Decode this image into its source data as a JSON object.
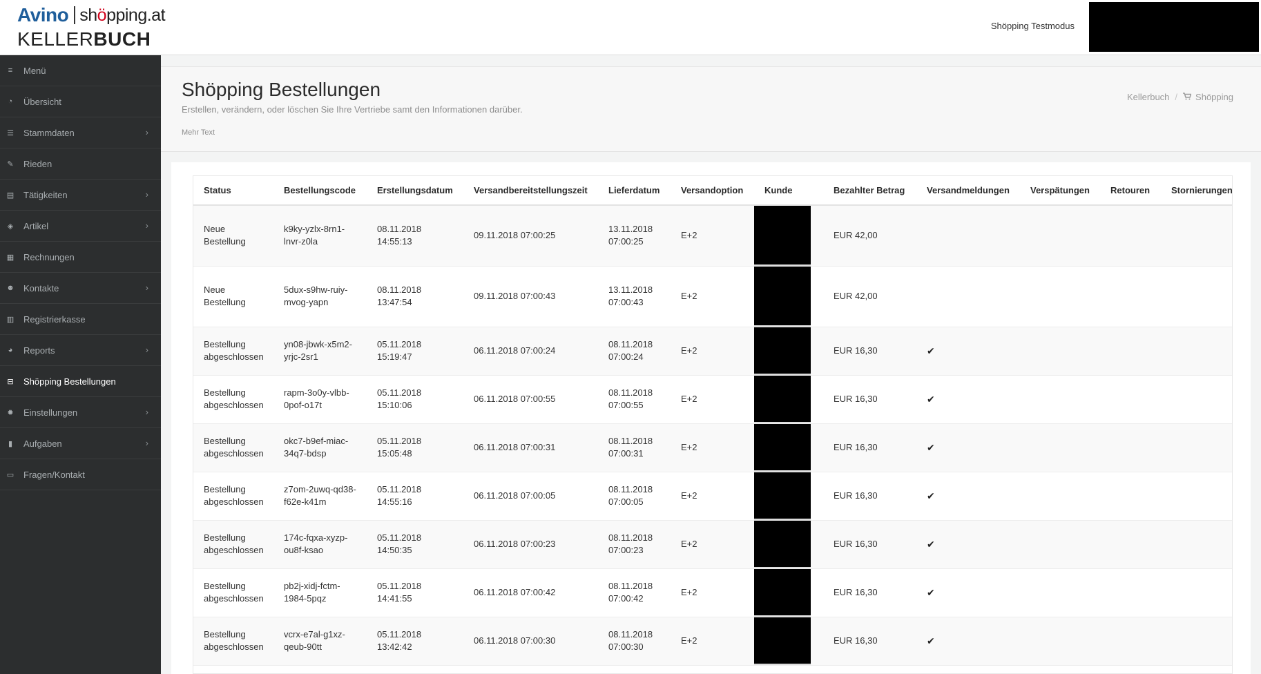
{
  "header": {
    "logo": {
      "brand": "Avino",
      "shop_prefix": "sh",
      "shop_mid": "ö",
      "shop_suffix": "pping.at",
      "line2_light": "KELLER",
      "line2_bold": "BUCH"
    },
    "testmode_label": "Shöpping Testmodus"
  },
  "sidebar": {
    "items": [
      {
        "label": "Menü",
        "icon": "bars-icon",
        "glyph": "≡",
        "has_children": false
      },
      {
        "label": "Übersicht",
        "icon": "dashboard-icon",
        "glyph": "◔",
        "has_children": false
      },
      {
        "label": "Stammdaten",
        "icon": "sliders-icon",
        "glyph": "☰",
        "has_children": true
      },
      {
        "label": "Rieden",
        "icon": "pencil-icon",
        "glyph": "✎",
        "has_children": false
      },
      {
        "label": "Tätigkeiten",
        "icon": "book-icon",
        "glyph": "▤",
        "has_children": true
      },
      {
        "label": "Artikel",
        "icon": "cube-icon",
        "glyph": "◈",
        "has_children": true
      },
      {
        "label": "Rechnungen",
        "icon": "list-alt-icon",
        "glyph": "▦",
        "has_children": false
      },
      {
        "label": "Kontakte",
        "icon": "users-icon",
        "glyph": "☻",
        "has_children": true
      },
      {
        "label": "Registrierkasse",
        "icon": "calculator-icon",
        "glyph": "▥",
        "has_children": false
      },
      {
        "label": "Reports",
        "icon": "pie-chart-icon",
        "glyph": "◕",
        "has_children": true
      },
      {
        "label": "Shöpping Bestellungen",
        "icon": "inbox-icon",
        "glyph": "⊟",
        "has_children": false,
        "active": true
      },
      {
        "label": "Einstellungen",
        "icon": "cog-icon",
        "glyph": "✹",
        "has_children": true
      },
      {
        "label": "Aufgaben",
        "icon": "bookmark-icon",
        "glyph": "▮",
        "has_children": true
      },
      {
        "label": "Fragen/Kontakt",
        "icon": "id-card-icon",
        "glyph": "▭",
        "has_children": false
      }
    ],
    "chevron": "›"
  },
  "page": {
    "title": "Shöpping Bestellungen",
    "subtitle": "Erstellen, verändern, oder löschen Sie Ihre Vertriebe samt den Informationen darüber.",
    "more_text": "Mehr Text",
    "breadcrumb": {
      "home": "Kellerbuch",
      "separator": "/",
      "current": "Shöpping",
      "current_icon": "shopping-cart-icon"
    }
  },
  "table": {
    "columns": [
      "Status",
      "Bestellungscode",
      "Erstellungsdatum",
      "Versandbereitstellungszeit",
      "Lieferdatum",
      "Versandoption",
      "Kunde",
      "Bezahlter Betrag",
      "Versandmeldungen",
      "Verspätungen",
      "Retouren",
      "Stornierungen"
    ],
    "rows": [
      {
        "status_1": "Neue",
        "status_2": "Bestellung",
        "code_1": "k9ky-yzlx-8rn1-",
        "code_2": "lnvr-z0la",
        "created_1": "08.11.2018",
        "created_2": "14:55:13",
        "ready": "09.11.2018 07:00:25",
        "delivery_1": "13.11.2018",
        "delivery_2": "07:00:25",
        "option": "E+2",
        "amount": "EUR 42,00",
        "shipped": ""
      },
      {
        "status_1": "Neue",
        "status_2": "Bestellung",
        "code_1": "5dux-s9hw-ruiy-",
        "code_2": "mvog-yapn",
        "created_1": "08.11.2018",
        "created_2": "13:47:54",
        "ready": "09.11.2018 07:00:43",
        "delivery_1": "13.11.2018",
        "delivery_2": "07:00:43",
        "option": "E+2",
        "amount": "EUR 42,00",
        "shipped": ""
      },
      {
        "status_1": "Bestellung",
        "status_2": "abgeschlossen",
        "code_1": "yn08-jbwk-x5m2-",
        "code_2": "yrjc-2sr1",
        "created_1": "05.11.2018",
        "created_2": "15:19:47",
        "ready": "06.11.2018 07:00:24",
        "delivery_1": "08.11.2018",
        "delivery_2": "07:00:24",
        "option": "E+2",
        "amount": "EUR 16,30",
        "shipped": "✔"
      },
      {
        "status_1": "Bestellung",
        "status_2": "abgeschlossen",
        "code_1": "rapm-3o0y-vlbb-",
        "code_2": "0pof-o17t",
        "created_1": "05.11.2018",
        "created_2": "15:10:06",
        "ready": "06.11.2018 07:00:55",
        "delivery_1": "08.11.2018",
        "delivery_2": "07:00:55",
        "option": "E+2",
        "amount": "EUR 16,30",
        "shipped": "✔"
      },
      {
        "status_1": "Bestellung",
        "status_2": "abgeschlossen",
        "code_1": "okc7-b9ef-miac-",
        "code_2": "34q7-bdsp",
        "created_1": "05.11.2018",
        "created_2": "15:05:48",
        "ready": "06.11.2018 07:00:31",
        "delivery_1": "08.11.2018",
        "delivery_2": "07:00:31",
        "option": "E+2",
        "amount": "EUR 16,30",
        "shipped": "✔"
      },
      {
        "status_1": "Bestellung",
        "status_2": "abgeschlossen",
        "code_1": "z7om-2uwq-qd38-",
        "code_2": "f62e-k41m",
        "created_1": "05.11.2018",
        "created_2": "14:55:16",
        "ready": "06.11.2018 07:00:05",
        "delivery_1": "08.11.2018",
        "delivery_2": "07:00:05",
        "option": "E+2",
        "amount": "EUR 16,30",
        "shipped": "✔"
      },
      {
        "status_1": "Bestellung",
        "status_2": "abgeschlossen",
        "code_1": "174c-fqxa-xyzp-",
        "code_2": "ou8f-ksao",
        "created_1": "05.11.2018",
        "created_2": "14:50:35",
        "ready": "06.11.2018 07:00:23",
        "delivery_1": "08.11.2018",
        "delivery_2": "07:00:23",
        "option": "E+2",
        "amount": "EUR 16,30",
        "shipped": "✔"
      },
      {
        "status_1": "Bestellung",
        "status_2": "abgeschlossen",
        "code_1": "pb2j-xidj-fctm-",
        "code_2": "1984-5pqz",
        "created_1": "05.11.2018",
        "created_2": "14:41:55",
        "ready": "06.11.2018 07:00:42",
        "delivery_1": "08.11.2018",
        "delivery_2": "07:00:42",
        "option": "E+2",
        "amount": "EUR 16,30",
        "shipped": "✔"
      },
      {
        "status_1": "Bestellung",
        "status_2": "abgeschlossen",
        "code_1": "vcrx-e7al-g1xz-",
        "code_2": "qeub-90tt",
        "created_1": "05.11.2018",
        "created_2": "13:42:42",
        "ready": "06.11.2018 07:00:30",
        "delivery_1": "08.11.2018",
        "delivery_2": "07:00:30",
        "option": "E+2",
        "amount": "EUR 16,30",
        "shipped": "✔"
      }
    ]
  }
}
